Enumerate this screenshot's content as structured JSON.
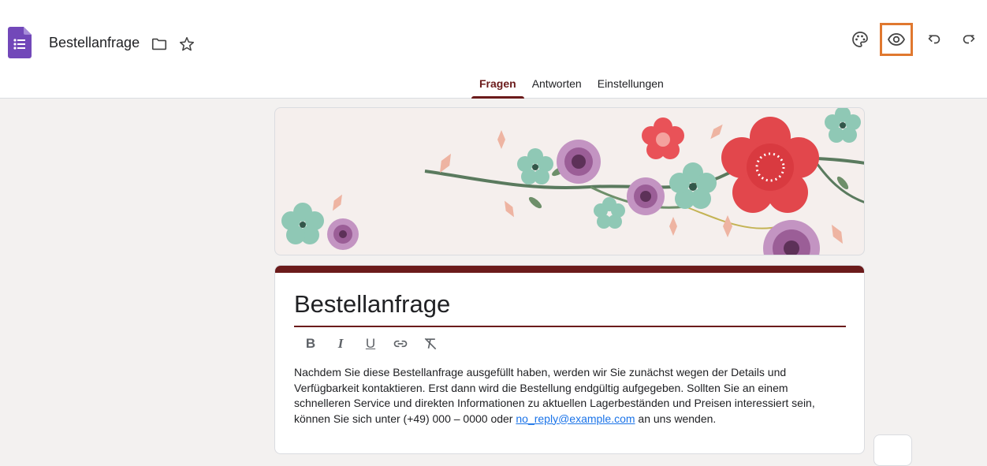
{
  "header": {
    "doc_title": "Bestellanfrage",
    "icons": [
      "forms-logo-icon",
      "folder-icon",
      "star-icon",
      "palette-icon",
      "preview-eye-icon",
      "undo-icon",
      "redo-icon"
    ],
    "accent_color": "#6b1b1b",
    "highlight_color": "#e0782f"
  },
  "tabs": [
    {
      "label": "Fragen",
      "active": true
    },
    {
      "label": "Antworten",
      "active": false
    },
    {
      "label": "Einstellungen",
      "active": false
    }
  ],
  "form": {
    "title": "Bestellanfrage",
    "format_buttons": [
      "B",
      "I",
      "U",
      "link-icon",
      "clear-format-icon"
    ],
    "description_part1": "Nachdem Sie diese Bestellanfrage ausgefüllt haben, werden wir Sie zunächst wegen der Details und Verfügbarkeit kontaktieren. Erst dann wird die Bestellung endgültig aufgegeben. Sollten Sie an einem schnelleren Service und direkten Informationen zu aktuellen Lagerbeständen und Preisen interessiert sein, können Sie sich unter (+49) 000 – 0000 oder ",
    "email": "no_reply@example.com",
    "description_part2": " an uns wenden."
  }
}
